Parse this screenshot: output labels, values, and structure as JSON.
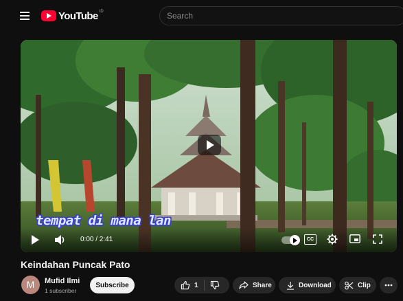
{
  "header": {
    "logo_text": "YouTube",
    "country_code": "ID",
    "search_placeholder": "Search"
  },
  "player": {
    "caption": "tempat di mana lan",
    "time": "0:00 / 2:41",
    "cc_label": "CC"
  },
  "video": {
    "title": "Keindahan Puncak Pato"
  },
  "channel": {
    "avatar_letter": "M",
    "name": "Mufid Ilmi",
    "subscribers": "1 subscriber",
    "subscribe_label": "Subscribe"
  },
  "actions": {
    "like_count": "1",
    "share_label": "Share",
    "download_label": "Download",
    "clip_label": "Clip"
  },
  "colors": {
    "background": "#0f0f0f",
    "brand_red": "#ff0033",
    "pill": "#272727"
  }
}
